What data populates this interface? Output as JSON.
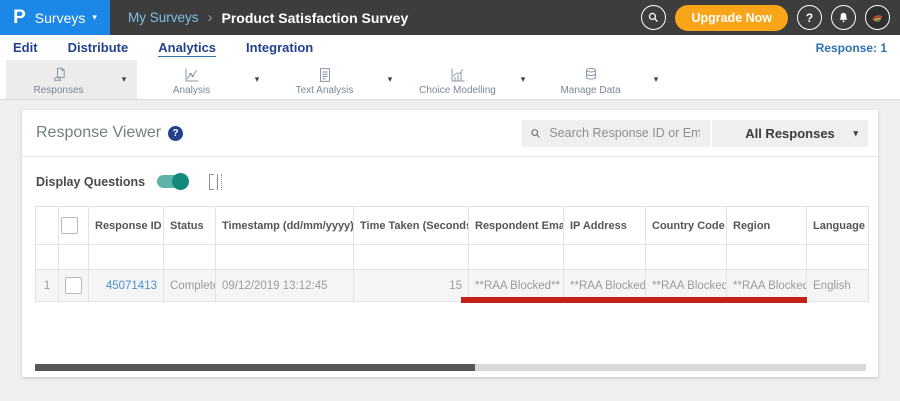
{
  "glyphs": {
    "caret_down": "▾",
    "breadcrumb_separator": "›",
    "help": "?"
  },
  "colors": {
    "topbar_bg": "#3d3d3d",
    "brand_blue": "#1b87e6",
    "navy": "#24418e",
    "upgrade_orange": "#f9a51a",
    "toggle_teal": "#13897c",
    "annotation_red": "#c4211d",
    "link_blue": "#4a90d2"
  },
  "topbar": {
    "logo_text": "P",
    "product_menu_label": "Surveys",
    "breadcrumb": {
      "parent": "My Surveys",
      "current": "Product Satisfaction Survey"
    },
    "upgrade_button_label": "Upgrade Now"
  },
  "tabbar": {
    "tabs": [
      {
        "label": "Edit"
      },
      {
        "label": "Distribute"
      },
      {
        "label": "Analytics",
        "active": true
      },
      {
        "label": "Integration"
      }
    ],
    "response_count": "Response: 1"
  },
  "ribbon": {
    "items": [
      {
        "label": "Responses",
        "icon": "hand-document-icon",
        "active": true
      },
      {
        "label": "Analysis",
        "icon": "line-chart-icon",
        "active": false
      },
      {
        "label": "Text Analysis",
        "icon": "text-document-icon",
        "active": false
      },
      {
        "label": "Choice Modelling",
        "icon": "bar-chart-icon",
        "active": false
      },
      {
        "label": "Manage Data",
        "icon": "database-icon",
        "active": false
      }
    ]
  },
  "viewer": {
    "title": "Response Viewer",
    "search_placeholder": "Search Response ID or Email",
    "responses_filter": "All Responses",
    "display_questions_label": "Display Questions",
    "display_questions_on": true
  },
  "table": {
    "columns": [
      {
        "label": "Response ID",
        "sort": "desc"
      },
      {
        "label": "Status",
        "sort": "none"
      },
      {
        "label": "Timestamp (dd/mm/yyyy)",
        "sort": "both"
      },
      {
        "label": "Time Taken (Seconds)",
        "sort": "both"
      },
      {
        "label": "Respondent Email",
        "sort": "none"
      },
      {
        "label": "IP Address",
        "sort": "none"
      },
      {
        "label": "Country Code",
        "sort": "none"
      },
      {
        "label": "Region",
        "sort": "none"
      },
      {
        "label": "Language",
        "sort": "none"
      }
    ],
    "rows": [
      {
        "row_number": "1",
        "response_id": "45071413",
        "status": "Completed",
        "timestamp": "09/12/2019 13:12:45",
        "time_taken": "15",
        "respondent_email": "**RAA Blocked**",
        "ip_address": "**RAA Blocked**",
        "country_code": "**RAA Blocked**",
        "region": "**RAA Blocked**",
        "language": "English"
      }
    ]
  }
}
